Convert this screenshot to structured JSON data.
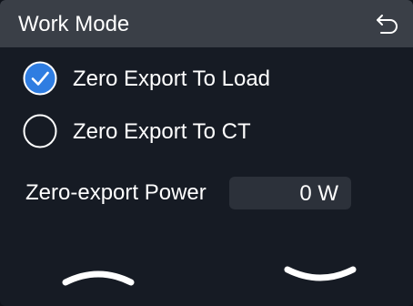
{
  "header": {
    "title": "Work Mode",
    "back_icon": "back-arrow-icon"
  },
  "work_mode": {
    "options": [
      {
        "label": "Zero Export To Load",
        "selected": true
      },
      {
        "label": "Zero Export To CT",
        "selected": false
      }
    ]
  },
  "power": {
    "label": "Zero-export Power",
    "value": "0 W"
  },
  "navigation": {
    "up_icon": "chevron-up-icon",
    "down_icon": "chevron-down-icon"
  },
  "colors": {
    "header_bg": "#3a3f47",
    "screen_bg": "#161b24",
    "accent": "#2f7de1",
    "field_bg": "#2c313a"
  }
}
